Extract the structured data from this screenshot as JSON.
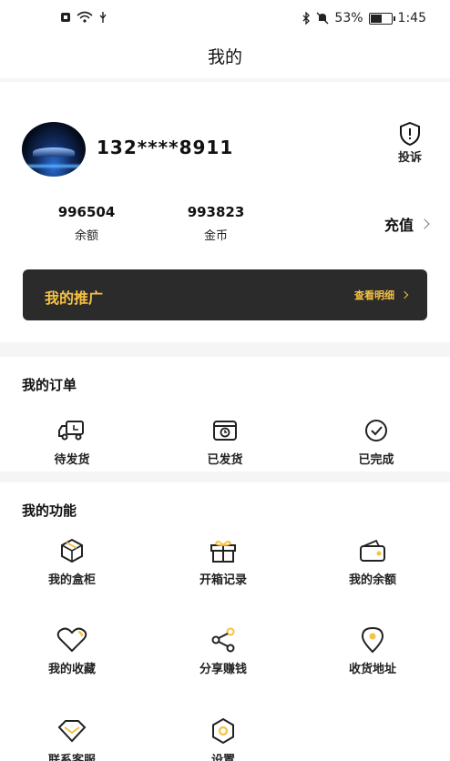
{
  "status_bar": {
    "battery": "53%",
    "time": "1:45"
  },
  "nav": {
    "title": "我的"
  },
  "profile": {
    "phone": "132****8911",
    "complain_label": "投诉"
  },
  "stats": [
    {
      "value": "996504",
      "label": "余额"
    },
    {
      "value": "993823",
      "label": "金币"
    }
  ],
  "recharge_label": "充值",
  "promo": {
    "label": "我的推广",
    "detail": "查看明细"
  },
  "orders": {
    "title": "我的订单",
    "items": [
      {
        "label": "待发货",
        "icon": "truck-icon"
      },
      {
        "label": "已发货",
        "icon": "box-clock-icon"
      },
      {
        "label": "已完成",
        "icon": "check-circle-icon"
      }
    ]
  },
  "functions": {
    "title": "我的功能",
    "items": [
      {
        "label": "我的盒柜",
        "icon": "cube-icon"
      },
      {
        "label": "开箱记录",
        "icon": "gift-icon"
      },
      {
        "label": "我的余额",
        "icon": "wallet-icon"
      },
      {
        "label": "我的收藏",
        "icon": "heart-icon"
      },
      {
        "label": "分享赚钱",
        "icon": "share-icon"
      },
      {
        "label": "收货地址",
        "icon": "location-icon"
      },
      {
        "label": "联系客服",
        "icon": "diamond-icon"
      },
      {
        "label": "设置",
        "icon": "settings-icon"
      }
    ]
  },
  "colors": {
    "accent": "#f5c242",
    "promo_bg": "#2b2b2b"
  }
}
